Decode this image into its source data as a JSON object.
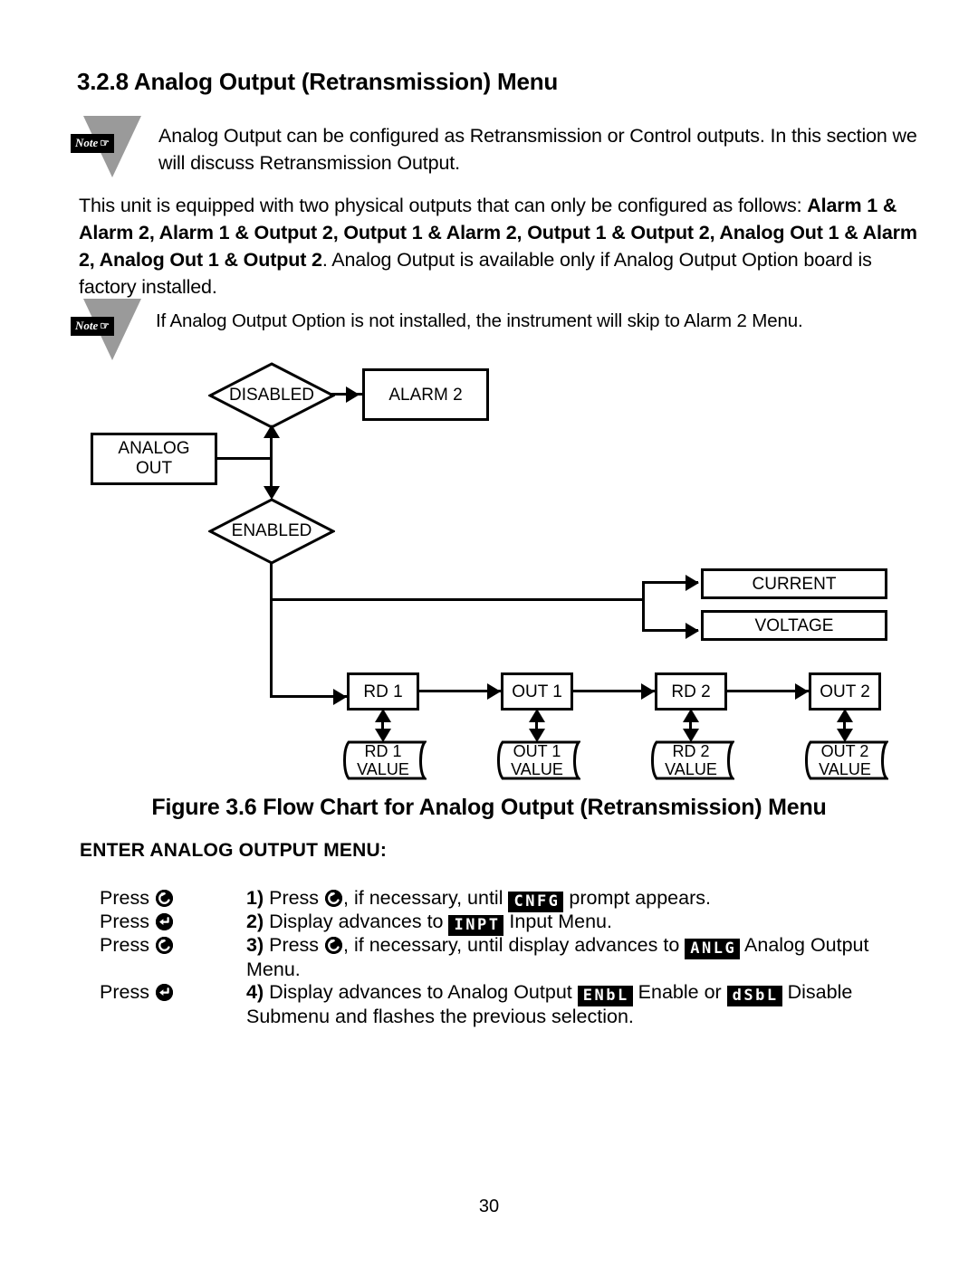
{
  "section": {
    "title": "3.2.8 Analog Output (Retransmission) Menu"
  },
  "notes": [
    {
      "icon_label": "Note",
      "icon_glyph": "☞",
      "text": "Analog Output can be configured as Retransmission or Control outputs. In this section we will discuss Retransmission Output."
    },
    {
      "icon_label": "Note",
      "icon_glyph": "☞",
      "text": "If Analog Output Option is not installed, the instrument will skip to Alarm 2 Menu."
    }
  ],
  "paragraph": {
    "lead": "This unit is equipped with two physical outputs that can only be configured as follows: ",
    "bold": "Alarm 1 & Alarm 2, Alarm 1 & Output 2, Output 1 & Alarm 2, Output 1 & Output 2, Analog Out 1 & Alarm 2, Analog Out 1 & Output 2",
    "tail": ". Analog Output is available only if Analog Output Option board is factory installed."
  },
  "flowchart": {
    "nodes": {
      "analog_out": "ANALOG\nOUT",
      "analog_out_line1": "ANALOG",
      "analog_out_line2": "OUT",
      "disabled": "DISABLED",
      "enabled": "ENABLED",
      "alarm2": "ALARM 2",
      "current": "CURRENT",
      "voltage": "VOLTAGE",
      "rd1": "RD 1",
      "out1": "OUT 1",
      "rd2": "RD 2",
      "out2": "OUT 2",
      "rd1_value_l1": "RD 1",
      "rd1_value_l2": "VALUE",
      "out1_value_l1": "OUT 1",
      "out1_value_l2": "VALUE",
      "rd2_value_l1": "RD 2",
      "rd2_value_l2": "VALUE",
      "out2_value_l1": "OUT 2",
      "out2_value_l2": "VALUE"
    }
  },
  "figure_caption": "Figure 3.6 Flow Chart for Analog Output (Retransmission) Menu",
  "subheading": "ENTER ANALOG OUTPUT MENU:",
  "steps": {
    "press_labels": [
      "Press",
      "Press",
      "Press",
      "Press"
    ],
    "items": [
      {
        "number": "1)",
        "pre": " Press ",
        "mid": ", if necessary, until ",
        "lcd": "CNFG",
        "post": " prompt appears."
      },
      {
        "number": "2)",
        "pre": " Display advances to ",
        "lcd": "INPT",
        "post": " Input Menu."
      },
      {
        "number": "3)",
        "pre": " Press ",
        "mid": ", if necessary, until display advances to ",
        "lcd": "ANLG",
        "post": " Analog Output Menu."
      },
      {
        "number": "4)",
        "pre": " Display advances to Analog Output ",
        "lcd": "ENbL",
        "mid": " Enable or ",
        "lcd2": "dSbL",
        "post": " Disable Submenu and flashes the previous selection."
      }
    ]
  },
  "page_number": "30",
  "colors": {
    "ink": "#000000",
    "paper": "#ffffff",
    "note_triangle": "#9a9a9a"
  }
}
